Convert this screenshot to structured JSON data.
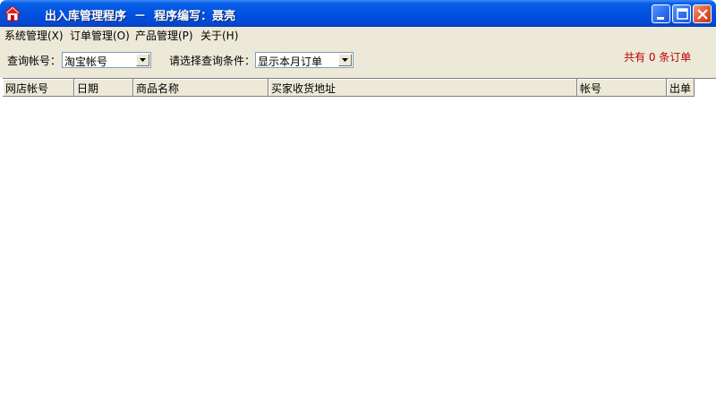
{
  "window": {
    "title": "出入库管理程序  －  程序编写：聂亮",
    "icon": "house-icon"
  },
  "menu": {
    "items": [
      {
        "label": "系统管理(X)"
      },
      {
        "label": "订单管理(O)"
      },
      {
        "label": "产品管理(P)"
      },
      {
        "label": "关于(H)"
      }
    ]
  },
  "filters": {
    "account_label": "查询帐号：",
    "account_value": "淘宝帐号",
    "condition_label": "请选择查询条件：",
    "condition_value": "显示本月订单"
  },
  "summary": {
    "order_count_text": "共有 0 条订单"
  },
  "table": {
    "columns": [
      "网店帐号",
      "日期",
      "商品名称",
      "买家收货地址",
      "帐号",
      "出单"
    ],
    "rows": []
  },
  "colors": {
    "titlebar": "#0052e0",
    "chrome": "#ece9d8",
    "count_text": "#c00000"
  }
}
